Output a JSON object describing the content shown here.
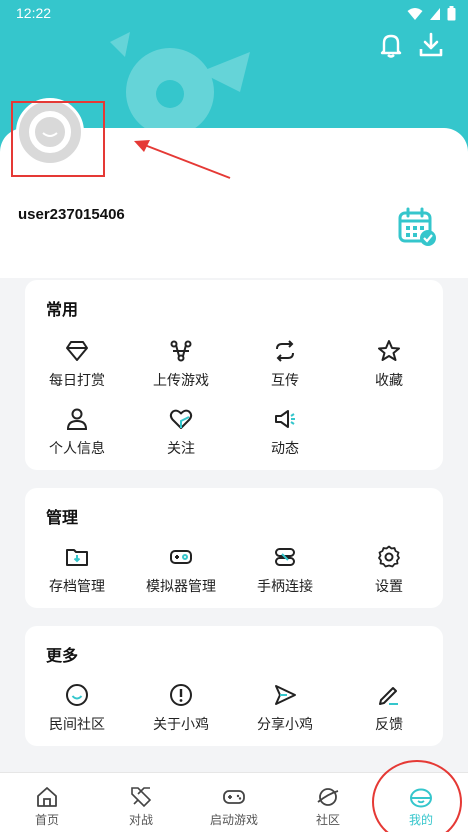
{
  "status_bar": {
    "time": "12:22"
  },
  "profile": {
    "username": "user237015406"
  },
  "sections": [
    {
      "title": "常用",
      "items": [
        {
          "label": "每日打赏",
          "icon": "diamond-icon"
        },
        {
          "label": "上传游戏",
          "icon": "upload-game-icon"
        },
        {
          "label": "互传",
          "icon": "transfer-icon"
        },
        {
          "label": "收藏",
          "icon": "star-icon"
        },
        {
          "label": "个人信息",
          "icon": "person-icon"
        },
        {
          "label": "关注",
          "icon": "heart-icon"
        },
        {
          "label": "动态",
          "icon": "megaphone-icon"
        }
      ]
    },
    {
      "title": "管理",
      "items": [
        {
          "label": "存档管理",
          "icon": "folder-icon"
        },
        {
          "label": "模拟器管理",
          "icon": "emulator-icon"
        },
        {
          "label": "手柄连接",
          "icon": "link-icon"
        },
        {
          "label": "设置",
          "icon": "gear-icon"
        }
      ]
    },
    {
      "title": "更多",
      "items": [
        {
          "label": "民间社区",
          "icon": "smile-icon"
        },
        {
          "label": "关于小鸡",
          "icon": "info-icon"
        },
        {
          "label": "分享小鸡",
          "icon": "send-icon"
        },
        {
          "label": "反馈",
          "icon": "pen-icon"
        }
      ]
    }
  ],
  "tabs": [
    {
      "label": "首页",
      "icon": "home-icon"
    },
    {
      "label": "对战",
      "icon": "swords-icon"
    },
    {
      "label": "启动游戏",
      "icon": "gamepad-icon"
    },
    {
      "label": "社区",
      "icon": "planet-icon"
    },
    {
      "label": "我的",
      "icon": "chick-face-icon",
      "active": true
    }
  ],
  "colors": {
    "accent": "#35c6cc",
    "annotation": "#e53935"
  }
}
